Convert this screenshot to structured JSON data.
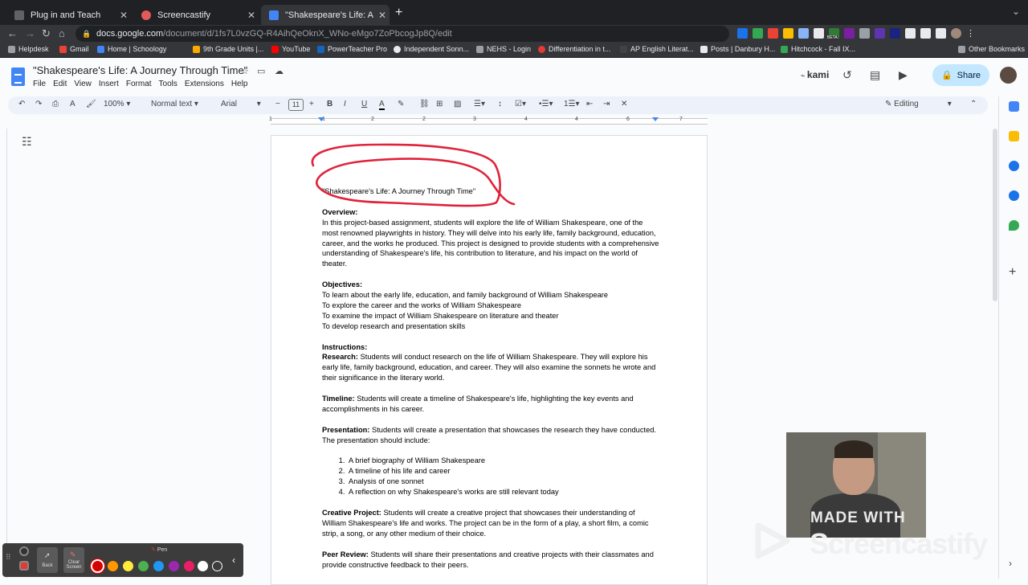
{
  "browser": {
    "tabs": [
      {
        "title": "Plug in and Teach",
        "color": "#5f6368"
      },
      {
        "title": "Screencastify",
        "color": "#e25a5a"
      },
      {
        "title": "\"Shakespeare's Life: A Journey",
        "color": "#4285f4"
      }
    ],
    "url_host": "docs.google.com",
    "url_path": "/document/d/1fs7L0vzGQ-R4AihQeOknX_WNo-eMgo7ZoPbcogJp8Q/edit",
    "bookmarks": [
      "Helpdesk",
      "Gmail",
      "Home | Schoology",
      "9th Grade Units |...",
      "YouTube",
      "PowerTeacher Pro",
      "Independent Sonn...",
      "NEHS - Login",
      "Differentiation in t...",
      "AP English Literat...",
      "Posts | Danbury H...",
      "Hitchcock - Fall IX...",
      "Other Bookmarks"
    ],
    "extension_badge": "BETA"
  },
  "docs": {
    "title": "\"Shakespeare's Life: A Journey Through Time\"",
    "menus": [
      "File",
      "Edit",
      "View",
      "Insert",
      "Format",
      "Tools",
      "Extensions",
      "Help"
    ],
    "kami": "kami",
    "share_label": "Share",
    "zoom": "100%",
    "style": "Normal text",
    "font": "Arial",
    "font_size": "11",
    "mode": "Editing",
    "ruler": [
      "1",
      "1",
      "2",
      "3",
      "4",
      "5",
      "6",
      "7"
    ]
  },
  "content": {
    "title_line": "\"Shakespeare's Life: A Journey Through Time\"",
    "overview_h": "Overview:",
    "overview": "In this project-based assignment, students will explore the life of William Shakespeare, one of the most renowned playwrights in history. They will delve into his early life, family background, education, career, and the works he produced. This project is designed to provide students with a comprehensive understanding of Shakespeare's life, his contribution to literature, and his impact on the world of theater.",
    "objectives_h": "Objectives:",
    "objectives": [
      "To learn about the early life, education, and family background of William Shakespeare",
      "To explore the career and the works of William Shakespeare",
      "To examine the impact of William Shakespeare on literature and theater",
      "To develop research and presentation skills"
    ],
    "instructions_h": "Instructions:",
    "research_h": "Research:",
    "research": " Students will conduct research on the life of William Shakespeare. They will explore his early life, family background, education, and career. They will also examine the sonnets he wrote and their significance in the literary world.",
    "timeline_h": "Timeline:",
    "timeline": " Students will create a timeline of Shakespeare's life, highlighting the key events and accomplishments in his career.",
    "presentation_h": "Presentation:",
    "presentation": " Students will create a presentation that showcases the research they have conducted. The presentation should include:",
    "presentation_items": [
      "A brief biography of William Shakespeare",
      "A timeline of his life and career",
      "Analysis of one sonnet",
      "A reflection on why Shakespeare's works are still relevant today"
    ],
    "creative_h": "Creative Project:",
    "creative": " Students will create a creative project that showcases their understanding of William Shakespeare's life and works. The project can be in the form of a play, a short film, a comic strip, a song, or any other medium of their choice.",
    "peer_h": "Peer Review:",
    "peer": " Students will share their presentations and creative projects with their classmates and provide constructive feedback to their peers."
  },
  "overlay": {
    "made_with": "MADE WITH",
    "brand": "Screencastify",
    "pen_label": "Pen",
    "back_label": "Back",
    "clear_label": "Clear Screen",
    "colors": [
      "#d50000",
      "#ff9800",
      "#ffeb3b",
      "#4caf50",
      "#2196f3",
      "#9c27b0",
      "#e91e63",
      "#ffffff"
    ]
  }
}
